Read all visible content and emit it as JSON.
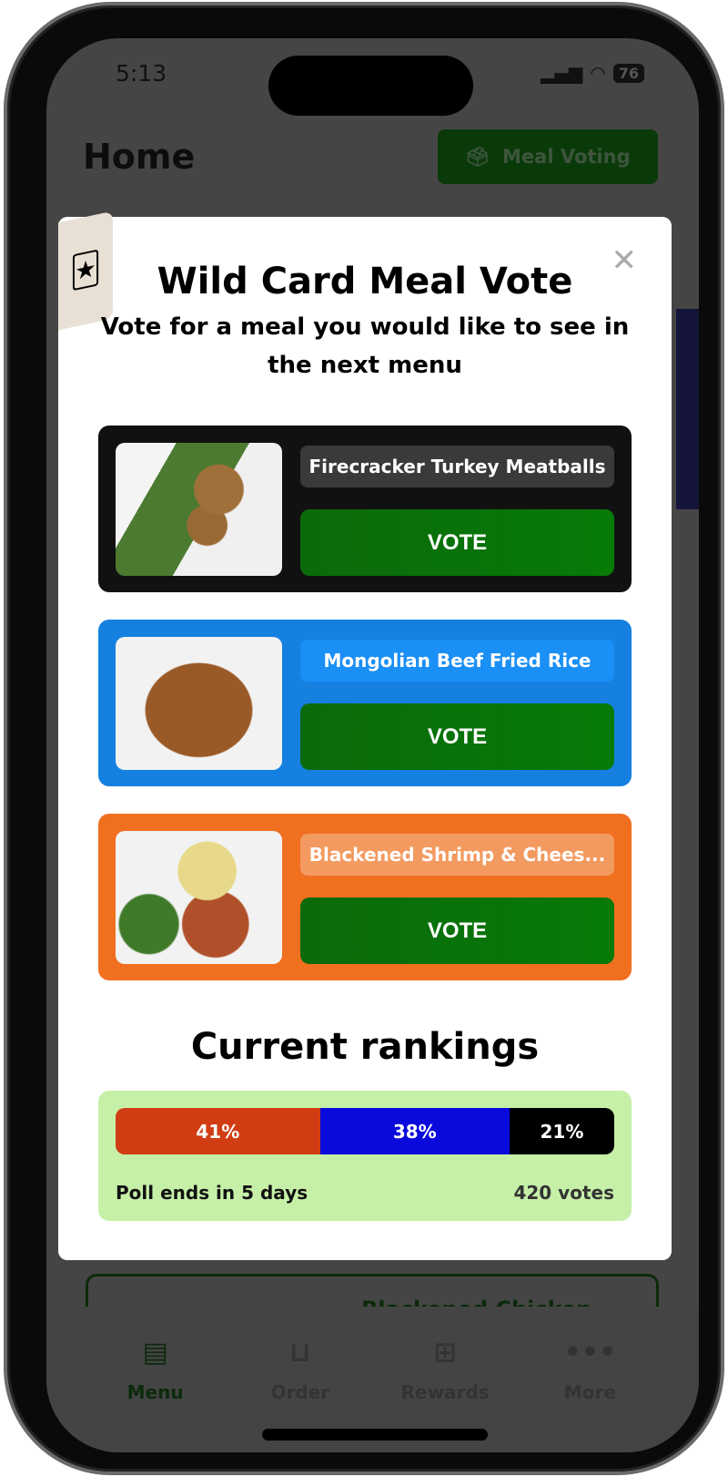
{
  "status": {
    "time": "5:13",
    "battery": "76"
  },
  "header": {
    "title": "Home",
    "meal_voting_label": "Meal Voting"
  },
  "background": {
    "card_title": "Blackened Chicken"
  },
  "modal": {
    "title": "Wild Card Meal Vote",
    "subtitle": "Vote for a meal you would like to see in the next menu",
    "meals": [
      {
        "name": "Firecracker Turkey Meatballs",
        "vote_label": "VOTE",
        "card_color": "#111111",
        "name_bg": "#3a3a3a"
      },
      {
        "name": "Mongolian Beef Fried Rice",
        "vote_label": "VOTE",
        "card_color": "#1580e0",
        "name_bg": "#1a8ff5"
      },
      {
        "name": "Blackened Shrimp & Chees...",
        "vote_label": "VOTE",
        "card_color": "#f07020",
        "name_bg": "#f39a60"
      }
    ],
    "rankings": {
      "title": "Current rankings",
      "segments": [
        {
          "label": "41%",
          "value": 41,
          "color": "#d13d12"
        },
        {
          "label": "38%",
          "value": 38,
          "color": "#0a0adc"
        },
        {
          "label": "21%",
          "value": 21,
          "color": "#000000"
        }
      ],
      "poll_ends": "Poll ends in 5 days",
      "votes": "420 votes"
    }
  },
  "nav": [
    {
      "label": "Menu",
      "icon": "menu-doc-icon",
      "active": true
    },
    {
      "label": "Order",
      "icon": "basket-icon",
      "active": false
    },
    {
      "label": "Rewards",
      "icon": "gift-icon",
      "active": false
    },
    {
      "label": "More",
      "icon": "more-dots-icon",
      "active": false
    }
  ]
}
